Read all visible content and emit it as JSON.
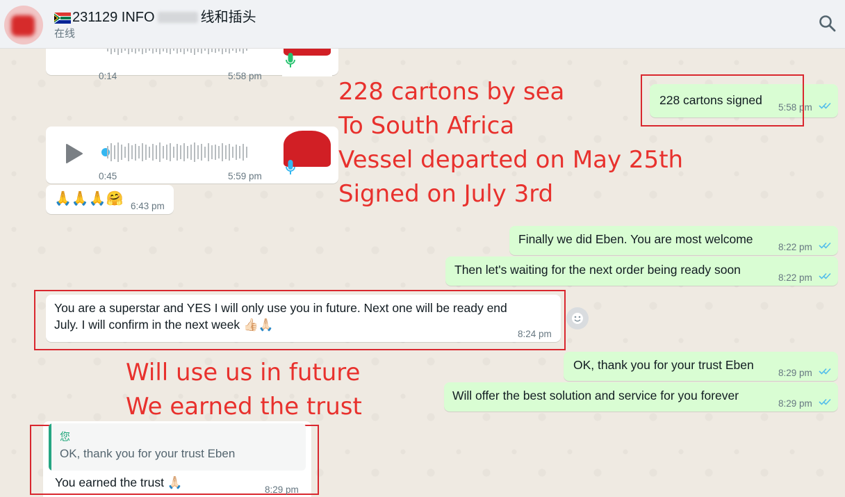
{
  "header": {
    "title_prefix": "231129 INFO",
    "title_suffix": "线和插头",
    "status": "在线",
    "search_icon": "search-icon"
  },
  "messages": [
    {
      "id": "voice1",
      "direction": "incoming",
      "kind": "voice",
      "duration": "0:14",
      "time": "5:58 pm"
    },
    {
      "id": "m228",
      "direction": "outgoing",
      "kind": "text",
      "text": "228 cartons signed",
      "time": "5:58 pm",
      "status": "read"
    },
    {
      "id": "voice2",
      "direction": "incoming",
      "kind": "voice",
      "duration": "0:45",
      "time": "5:59 pm"
    },
    {
      "id": "emoji1",
      "direction": "incoming",
      "kind": "emoji",
      "text": "🙏🙏🙏🤗",
      "time": "6:43 pm"
    },
    {
      "id": "m1",
      "direction": "outgoing",
      "kind": "text",
      "text": "Finally we did Eben. You are most welcome",
      "time": "8:22 pm",
      "status": "read"
    },
    {
      "id": "m2",
      "direction": "outgoing",
      "kind": "text",
      "text": "Then let's waiting for the next order being ready soon",
      "time": "8:22 pm",
      "status": "read"
    },
    {
      "id": "m3",
      "direction": "incoming",
      "kind": "text",
      "lines": [
        "You are a superstar and YES I will only use you in future. Next one will be ready end",
        "July. I will confirm in the next week 👍🏻🙏🏻"
      ],
      "time": "8:24 pm"
    },
    {
      "id": "m4",
      "direction": "outgoing",
      "kind": "text",
      "text": "OK, thank you for your trust Eben",
      "time": "8:29 pm",
      "status": "read"
    },
    {
      "id": "m5",
      "direction": "outgoing",
      "kind": "text",
      "text": "Will offer the best solution and service for you forever",
      "time": "8:29 pm",
      "status": "read"
    },
    {
      "id": "m6",
      "direction": "incoming",
      "kind": "reply",
      "quote_author": "您",
      "quote_text": "OK, thank you for your trust Eben",
      "text": "You earned the trust 🙏🏻",
      "time": "8:29 pm"
    }
  ],
  "annotations": {
    "shipping": [
      "228 cartons by sea",
      "To South Africa",
      "Vessel departed on May 25th",
      "Signed on July 3rd"
    ],
    "trust": [
      "Will use us in future",
      "We earned the trust"
    ],
    "color": "#e8312d"
  },
  "colors": {
    "incoming_bubble": "#ffffff",
    "outgoing_bubble": "#d9fdd3",
    "read_tick": "#53bdeb",
    "chat_background": "#efeae2",
    "annotation_box": "#d9272e"
  }
}
